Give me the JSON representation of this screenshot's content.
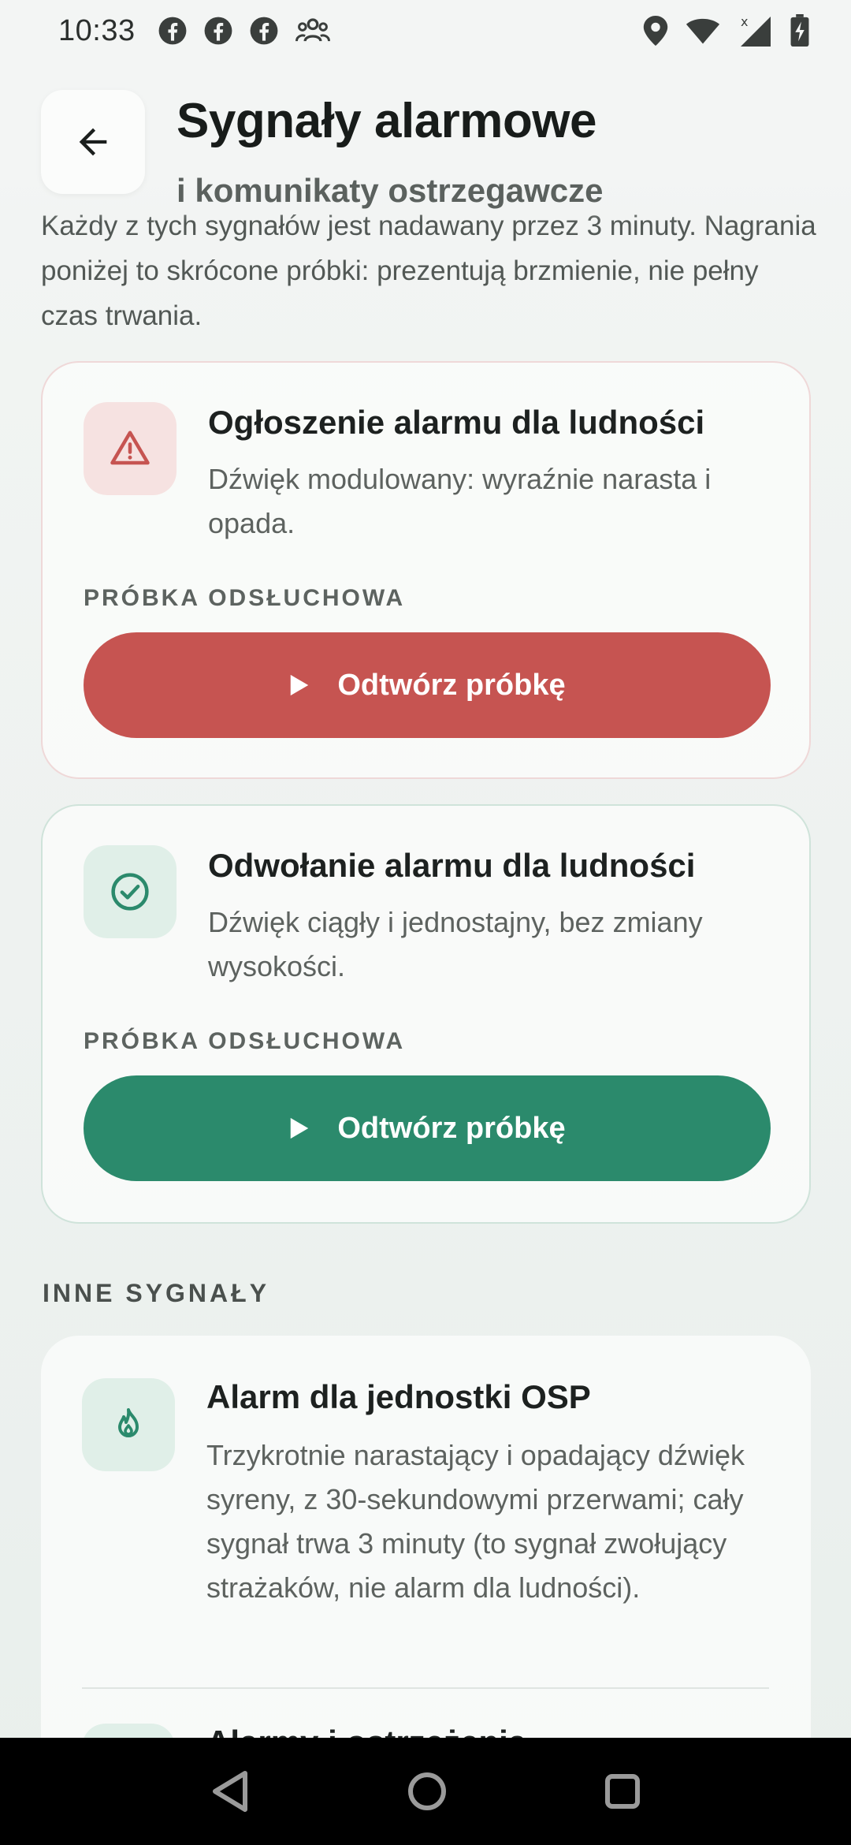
{
  "status_bar": {
    "time": "10:33",
    "icons": [
      "facebook-icon",
      "facebook-icon",
      "facebook-icon",
      "people-icon",
      "location-icon",
      "wifi-icon",
      "signal-icon",
      "battery-icon"
    ]
  },
  "header": {
    "title": "Sygnały alarmowe",
    "subtitle": "i komunikaty ostrzegawcze"
  },
  "intro": {
    "text": "Każdy z tych sygnałów jest nadawany przez 3 minuty. Nagrania poniżej to skrócone próbki: prezentują brzmienie, nie pełny czas trwania."
  },
  "cards": [
    {
      "title": "Ogłoszenie alarmu dla ludności",
      "description": "Dźwięk modulowany: wyraźnie narasta i opada.",
      "sample_label": "PRÓBKA ODSŁUCHOWA",
      "button_label": "Odtwórz próbkę",
      "icon": "warning-icon",
      "color": "#c65451"
    },
    {
      "title": "Odwołanie alarmu dla ludności",
      "description": "Dźwięk ciągły i jednostajny, bez zmiany wysokości.",
      "sample_label": "PRÓBKA ODSŁUCHOWA",
      "button_label": "Odtwórz próbkę",
      "icon": "check-circle-icon",
      "color": "#2b8a6c"
    }
  ],
  "other_signals": {
    "heading": "INNE SYGNAŁY",
    "items": [
      {
        "title": "Alarm dla jednostki OSP",
        "description": "Trzykrotnie narastający i opadający dźwięk syreny, z 30-sekundowymi przerwami; cały sygnał trwa 3 minuty (to sygnał zwołujący strażaków, nie alarm dla ludności).",
        "icon": "fire-icon"
      },
      {
        "title": "Alarmy i ostrzeżenia",
        "description": "",
        "icon": ""
      }
    ]
  },
  "nav_bar": {
    "buttons": [
      "back-nav-icon",
      "home-nav-icon",
      "recents-nav-icon"
    ]
  }
}
